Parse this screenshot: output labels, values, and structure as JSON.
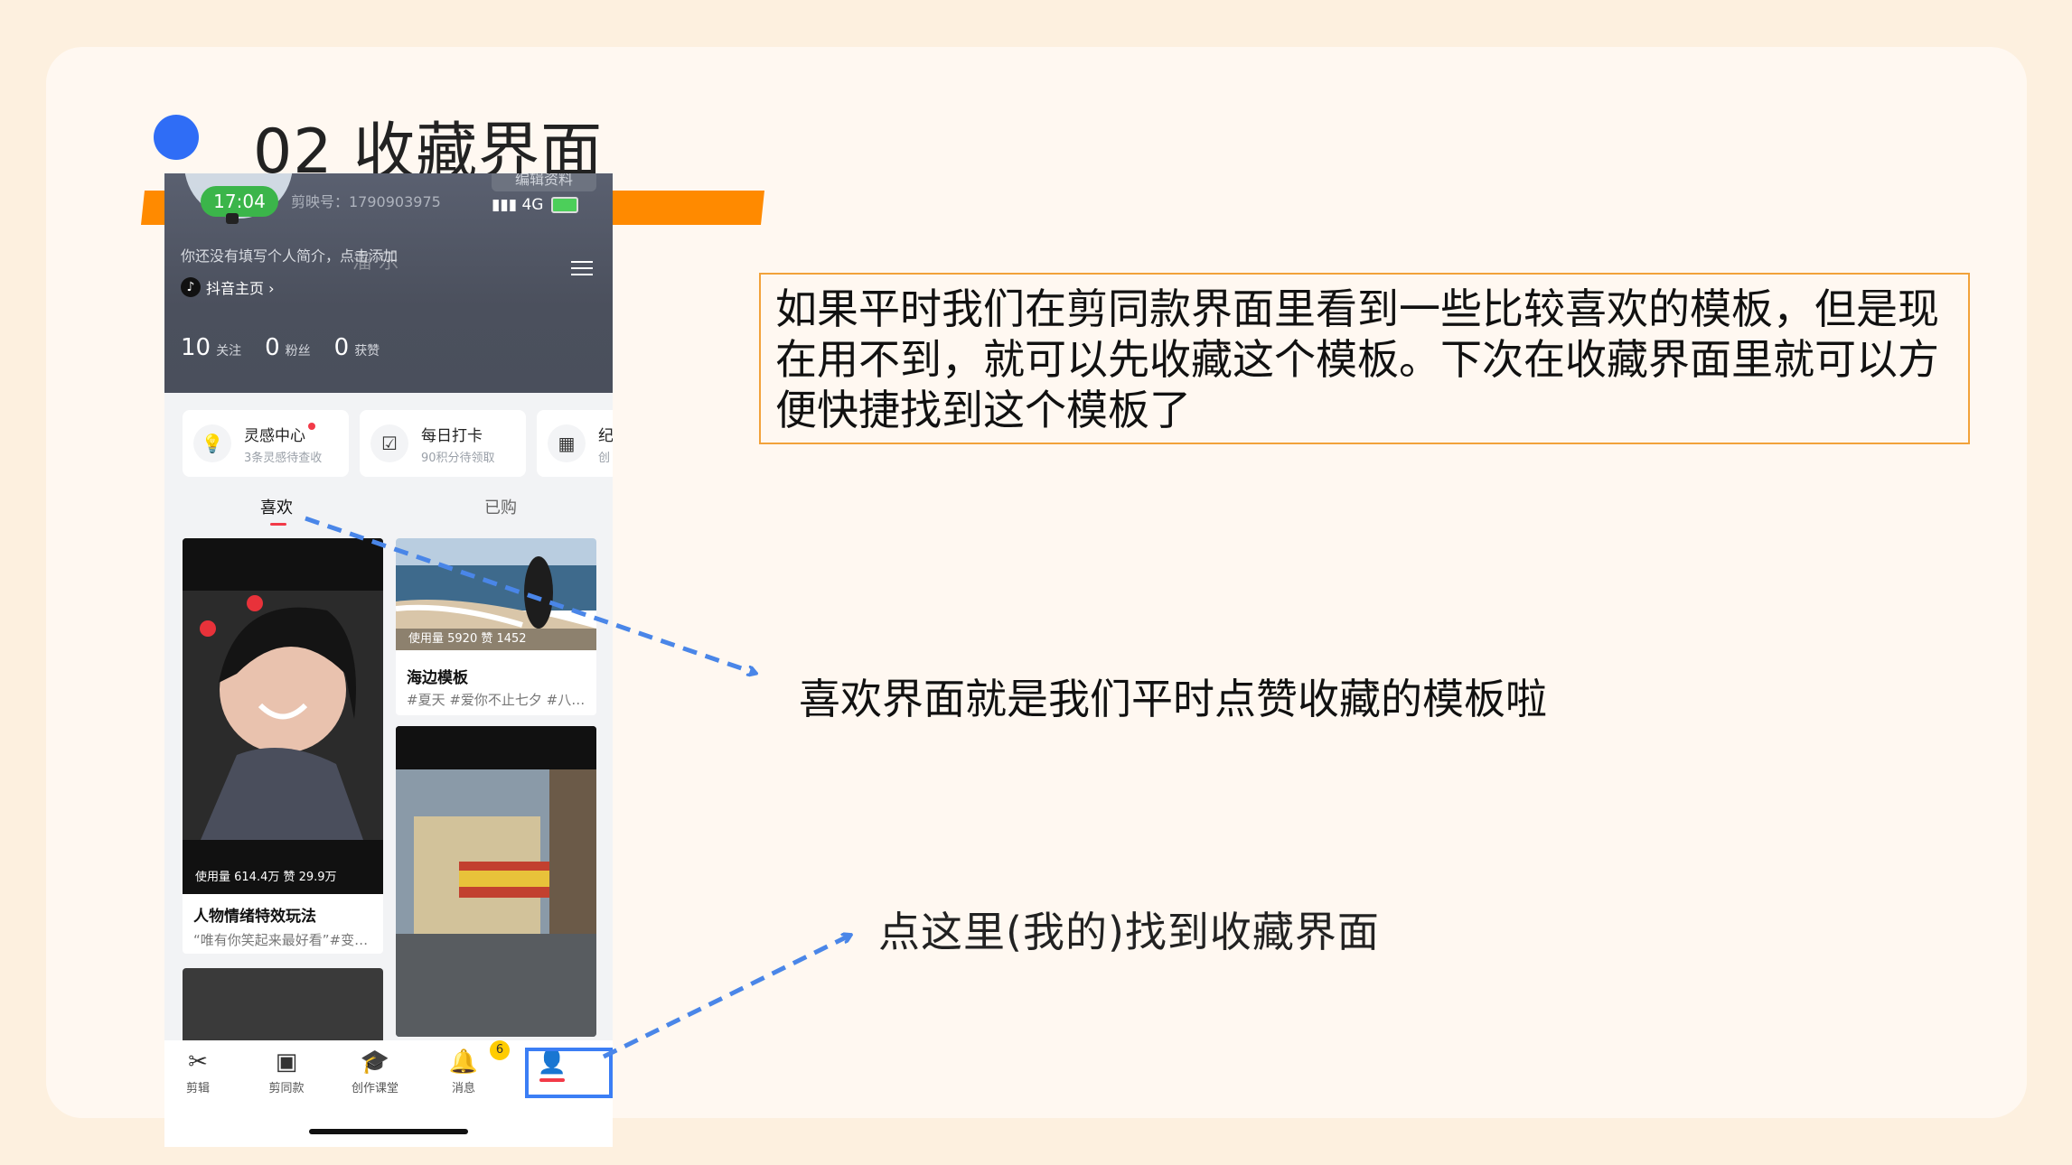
{
  "slide": {
    "title": "02 收藏界面",
    "callout": "如果平时我们在剪同款界面里看到一些比较喜欢的模板，但是现在用不到，就可以先收藏这个模板。下次在收藏界面里就可以方便快捷找到这个模板了",
    "note_like": "喜欢界面就是我们平时点赞收藏的模板啦",
    "note_profile": "点这里(我的)找到收藏界面"
  },
  "phone": {
    "status_time": "17:04",
    "network": "4G",
    "id_label": "剪映号：1790903975",
    "edit_profile": "编辑资料",
    "intro": "你还没有填写个人简介，点击添加",
    "watermark": "溜 乐",
    "douyin_link": "抖音主页 ›",
    "stats": [
      {
        "num": "10",
        "label": "关注"
      },
      {
        "num": "0",
        "label": "粉丝"
      },
      {
        "num": "0",
        "label": "获赞"
      }
    ],
    "cards": [
      {
        "title": "灵感中心",
        "sub": "3条灵感待查收"
      },
      {
        "title": "每日打卡",
        "sub": "90积分待领取"
      },
      {
        "title": "纪",
        "sub": "创"
      }
    ],
    "tabs": {
      "liked": "喜欢",
      "bought": "已购"
    },
    "tiles": [
      {
        "usage": "使用量  614.4万   赞 29.9万",
        "title": "人物情绪特效玩法",
        "sub": "“唯有你笑起来最好看”#变…"
      },
      {
        "usage": "使用量  5920   赞 1452",
        "title": "海边模板",
        "sub": "#夏天 #爱你不止七夕 #八…"
      }
    ],
    "tabbar": [
      {
        "label": "剪辑"
      },
      {
        "label": "剪同款"
      },
      {
        "label": "创作课堂"
      },
      {
        "label": "消息",
        "badge": "6"
      },
      {
        "label": ""
      }
    ]
  },
  "colors": {
    "accent": "#2f6df6",
    "orange": "#ff8a00",
    "arrow": "#4a86e8"
  }
}
